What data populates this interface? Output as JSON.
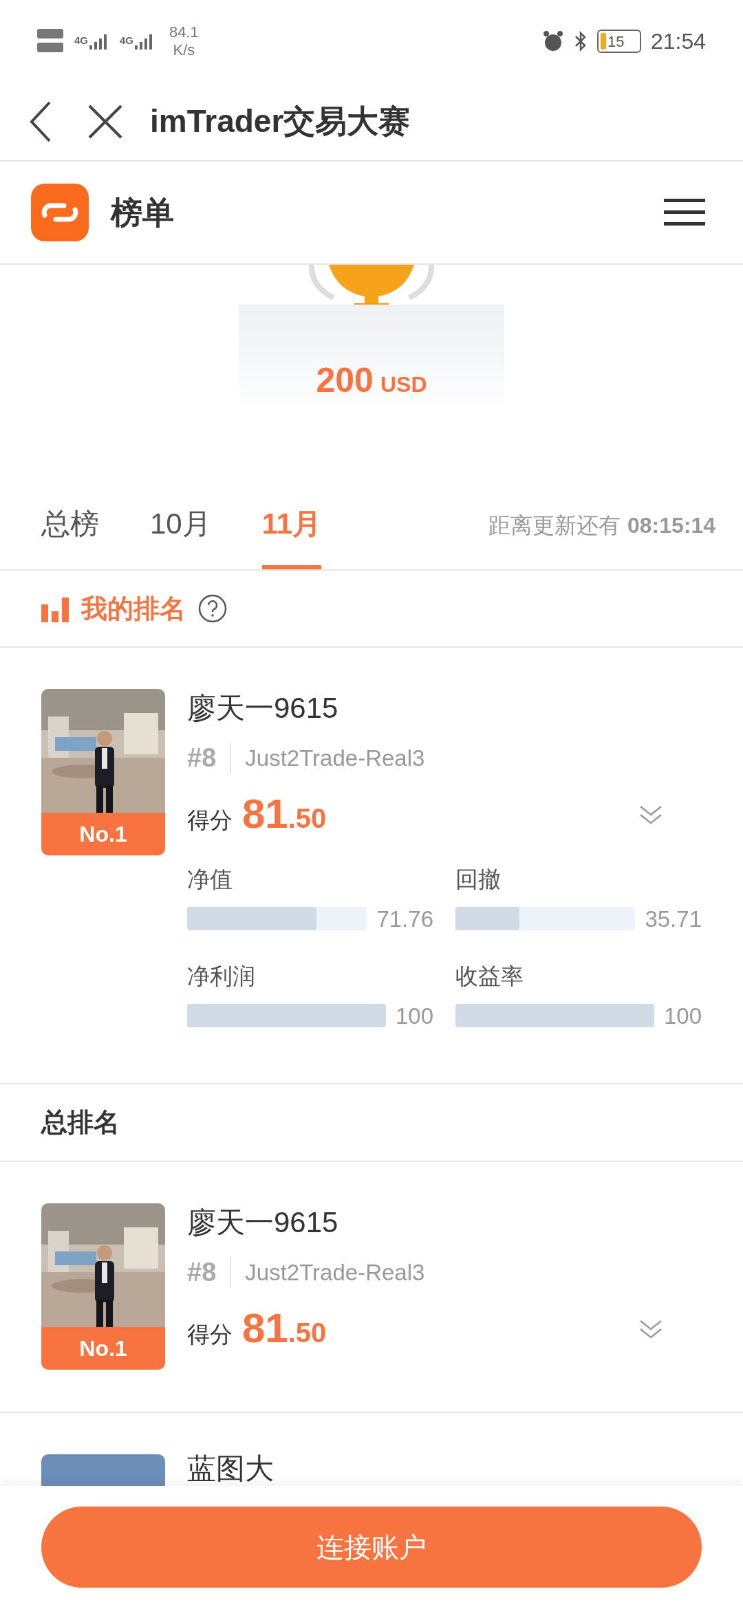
{
  "status_bar": {
    "networks": [
      {
        "label": "4G"
      },
      {
        "label": "4G"
      }
    ],
    "speed": "84.1",
    "speed_unit": "K/s",
    "battery": "15",
    "time": "21:54"
  },
  "title_bar": {
    "title": "imTrader交易大赛"
  },
  "header": {
    "title": "榜单"
  },
  "prize": {
    "amount": "200",
    "currency": "USD"
  },
  "tabs": [
    {
      "label": "总榜",
      "selected": false
    },
    {
      "label": "10月",
      "selected": false
    },
    {
      "label": "11月",
      "selected": true
    }
  ],
  "countdown": {
    "label": "距离更新还有",
    "time": "08:15:14"
  },
  "my_ranking": {
    "title": "我的排名",
    "entry": {
      "name": "廖天一9615",
      "badge": "No.1",
      "rank": "#8",
      "account": "Just2Trade-Real3",
      "score_label": "得分",
      "score_main": "81",
      "score_fraction": ".50",
      "metrics": [
        {
          "label": "净值",
          "level": 0.7176,
          "reading": "71.76"
        },
        {
          "label": "回撤",
          "level": 0.3571,
          "reading": "35.71"
        },
        {
          "label": "净利润",
          "level": 1,
          "reading": "100"
        },
        {
          "label": "收益率",
          "level": 1,
          "reading": "100"
        }
      ]
    }
  },
  "overall_ranking": {
    "title": "总排名",
    "entries": [
      {
        "name": "廖天一9615",
        "badge": "No.1",
        "rank": "#8",
        "account": "Just2Trade-Real3",
        "score_label": "得分",
        "score_main": "81",
        "score_fraction": ".50"
      },
      {
        "name": "蓝图大",
        "kind": "partial"
      }
    ]
  },
  "connect_button": {
    "label": "连接账户"
  }
}
